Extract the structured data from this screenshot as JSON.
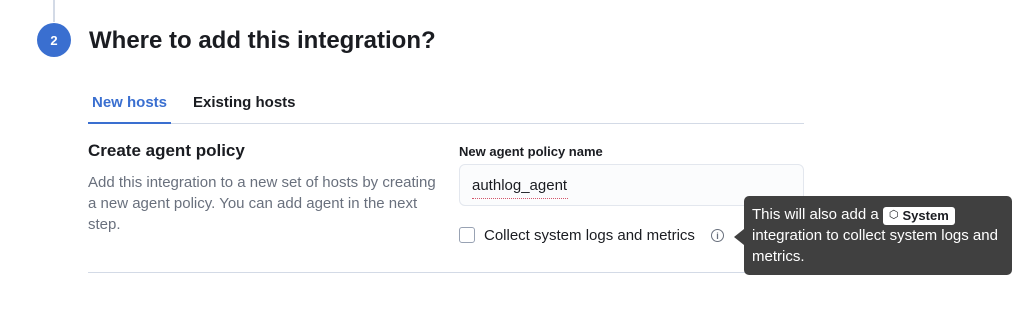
{
  "step": {
    "number": "2",
    "title": "Where to add this integration?"
  },
  "tabs": [
    {
      "label": "New hosts",
      "active": true
    },
    {
      "label": "Existing hosts",
      "active": false
    }
  ],
  "section": {
    "title": "Create agent policy",
    "description": "Add this integration to a new set of hosts by creating a new agent policy. You can add agent in the next step."
  },
  "form": {
    "policy_name_label": "New agent policy name",
    "policy_name_value": "authlog_agent",
    "checkbox_label": "Collect system logs and metrics",
    "checkbox_checked": false
  },
  "tooltip": {
    "text_before": "This will also add a",
    "badge_label": "System",
    "badge_icon": "package-icon",
    "text_after": "integration to collect system logs and metrics."
  },
  "colors": {
    "accent": "#3a6fd0",
    "tooltip_bg": "#404040"
  }
}
